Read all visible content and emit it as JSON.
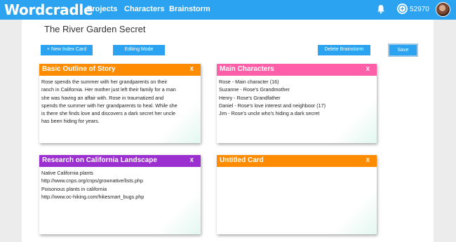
{
  "app": {
    "logo": "Wordcradle",
    "accent": "#2ba3f0"
  },
  "nav": {
    "projects": "Projects",
    "characters": "Characters",
    "brainstorm": "Brainstorm"
  },
  "user": {
    "coins": "52970"
  },
  "page": {
    "title": "The River Garden Secret"
  },
  "toolbar": {
    "new_card": "+ New Index Card",
    "editing_mode": "Editing Mode",
    "delete_brainstorm": "Delete Brainstorm",
    "save": "Save"
  },
  "cards": [
    {
      "title": "Basic Outline of Story",
      "close": "X",
      "color": "#ff8c00",
      "lines": [
        "Rose spends the summer with her grandparents on their",
        "ranch in California. Her mother just left their family for a man",
        "she was having an affair with. Rose in traumatized and",
        "spends the summer with her grandparents to heal. While she",
        "is there she finds love and discovers a dark secret her uncle",
        "has been hiding for years."
      ]
    },
    {
      "title": "Main Characters",
      "close": "X",
      "color": "#ff5fa8",
      "lines": [
        "Rose - Main character (16)",
        "Suzanne - Rose's Grandmother",
        "Henry - Rose's Grandfather",
        "Daniel - Rose's love interest and neighboor (17)",
        "Jim - Rose's uncle who's hiding a dark secret"
      ]
    },
    {
      "title": "Research on California Landscape",
      "close": "X",
      "color": "#9b2fcf",
      "lines": [
        "Native California plants",
        "http://www.cnps.org/cnps/grownative/lists.php",
        "Poisonous plants in california",
        "http://www.oc-hiking.com/hikesmart_bugs.php"
      ]
    },
    {
      "title": "Untitled Card",
      "close": "X",
      "color": "#ff8c00",
      "lines": []
    }
  ]
}
